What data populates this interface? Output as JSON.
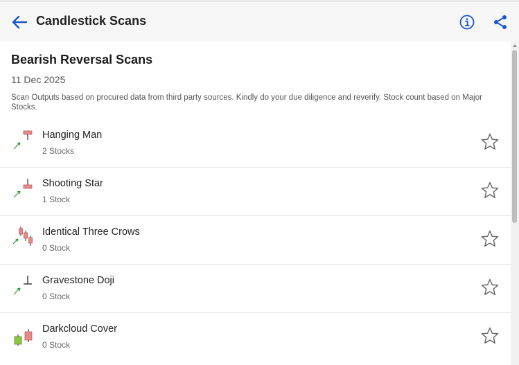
{
  "header": {
    "title": "Candlestick Scans",
    "back_icon": "arrow-left-icon",
    "info_icon": "info-icon",
    "share_icon": "share-icon",
    "accent": "#1a56c8"
  },
  "section": {
    "title": "Bearish Reversal Scans",
    "date": "11 Dec 2025",
    "disclaimer": "Scan Outputs based on procured data from third party sources. Kindly do your due diligence and reverify. Stock count based on Major Stocks."
  },
  "scans": [
    {
      "name": "Hanging Man",
      "count": "2 Stocks",
      "icon": "hanging-man-icon"
    },
    {
      "name": "Shooting Star",
      "count": "1 Stock",
      "icon": "shooting-star-icon"
    },
    {
      "name": "Identical Three Crows",
      "count": "0 Stock",
      "icon": "three-crows-icon"
    },
    {
      "name": "Gravestone Doji",
      "count": "0 Stock",
      "icon": "gravestone-doji-icon"
    },
    {
      "name": "Darkcloud Cover",
      "count": "0 Stock",
      "icon": "darkcloud-cover-icon"
    }
  ],
  "colors": {
    "bearish": "#e88a8a",
    "bullish": "#8cc63f",
    "trend_arrow": "#2e9a3a",
    "star_outline": "#6b6b6b"
  }
}
